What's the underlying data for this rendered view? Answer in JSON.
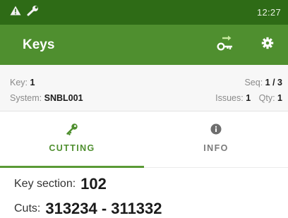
{
  "status_bar": {
    "time": "12:27",
    "icons": [
      "warning-icon",
      "wrench-icon"
    ]
  },
  "app_bar": {
    "title": "Keys",
    "actions": [
      "key-transfer-icon",
      "settings-gear-icon"
    ]
  },
  "info": {
    "key_label": "Key:",
    "key_value": "1",
    "system_label": "System:",
    "system_value": "SNBL001",
    "seq_label": "Seq:",
    "seq_value": "1 / 3",
    "issues_label": "Issues:",
    "issues_value": "1",
    "qty_label": "Qty:",
    "qty_value": "1"
  },
  "tabs": [
    {
      "label": "CUTTING",
      "icon": "key-icon",
      "selected": true
    },
    {
      "label": "INFO",
      "icon": "info-icon",
      "selected": false
    }
  ],
  "details": {
    "key_section_label": "Key section:",
    "key_section_value": "102",
    "cuts_label": "Cuts:",
    "cuts_value": "313234 - 311332"
  },
  "colors": {
    "status_bar": "#2e6b16",
    "app_bar": "#4f8f2f",
    "accent": "#5a9a35"
  }
}
